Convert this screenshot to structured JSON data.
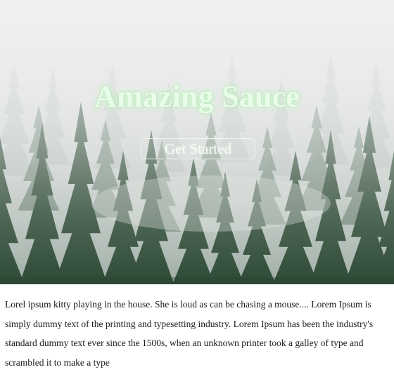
{
  "hero": {
    "title": "Amazing Sauce",
    "cta_label": "Get Started"
  },
  "content": {
    "paragraph": "Lorel ipsum kitty playing in the house. She is loud as can be chasing a mouse.... Lorem Ipsum is simply dummy text of the printing and typesetting industry. Lorem Ipsum has been the industry's standard dummy text ever since the 1500s, when an unknown printer took a galley of type and scrambled it to make a type"
  },
  "colors": {
    "title": "#e9fbe9",
    "cta_border": "#eef7ee",
    "body_text": "#1b1b1b",
    "forest_dark": "#2d4a35",
    "fog": "#e6e7e6"
  }
}
